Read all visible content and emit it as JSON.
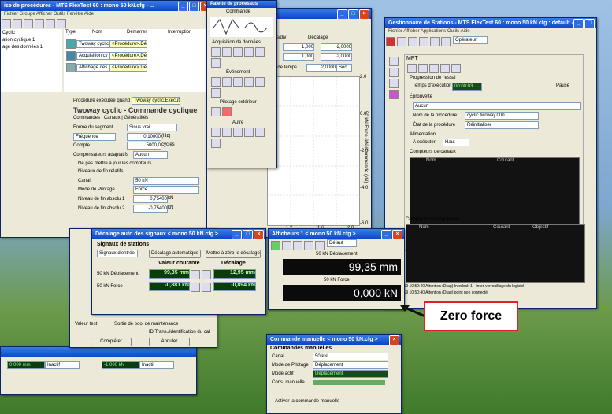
{
  "procwin": {
    "title": "ise de procédures - MTS FlexTest 60 : mono 50 kN.cfg - ...",
    "menu": "Fichier  Groupe  Afficher  Outils  Fenêtre  Aide",
    "tree": [
      "Cyclic",
      "ation cyclique 1",
      "age des données 1"
    ],
    "cols": [
      "Type",
      "Nom",
      "Démarrer",
      "Interruption"
    ],
    "rows": [
      [
        "Twoway cyclic",
        "<Procédure>.Dém"
      ],
      [
        "Acquisition cy",
        "<Procédure>.Dém"
      ],
      [
        "Affichage des",
        "<Procédure>.Dém"
      ]
    ],
    "exec_label": "Procédure exécutée quand",
    "exec_value": "Twoway cyclic.Exécuté",
    "section_title": "Twoway cyclic - Commande cyclique",
    "tabs": "Commandes | Canaux | Généralités",
    "form": [
      [
        "Forme du segment",
        "Sinus vrai"
      ],
      [
        "Fréquence",
        "0,10000",
        "(Hz)"
      ],
      [
        "Compte",
        "5000,0",
        "cycles"
      ],
      [
        "Compensateurs adaptatifs",
        "Aucun"
      ],
      [
        "Ne pas mettre à jour les compteurs",
        ""
      ],
      [
        "Niveaux de fin relatifs",
        ""
      ],
      [
        "Canal",
        "50 kN"
      ],
      [
        "Mode de Pilotage",
        "Force"
      ],
      [
        "Niveau de fin absolu 1",
        "0,75400",
        "kN"
      ],
      [
        "Niveau de fin absolu 2",
        "-0,75400",
        "kN"
      ]
    ]
  },
  "palette": {
    "title": "Palette de processus",
    "sections": [
      "Commande",
      "Acquisition de données",
      "Événement",
      "Pilotage extérieur",
      "Autre"
    ]
  },
  "scope": {
    "cols": [
      "Unités/div",
      "Décalage"
    ],
    "rows": [
      [
        "1,000",
        "-2,0000"
      ],
      [
        "1,000",
        "-2,0000"
      ]
    ],
    "timebase_label": "Base de temps",
    "timebase": "2,0000",
    "unit": "Sec",
    "ylabels": [
      "2.0",
      "0.0",
      "-2.0",
      "-4.0",
      "-6.0"
    ],
    "xlabels": [
      "1.2",
      "1.6",
      "2.0"
    ],
    "axis": "50 kN Force (kN)/Commande (kN)"
  },
  "station": {
    "title": "Gestionnaire de Stations - MTS FlexTest 60 : mono 50 kN.cfg : default -",
    "menu": "Fichier  Afficher  Applications  Outils  Aide",
    "operator": "Opérateur",
    "panel_title": "MPT",
    "progression": "Progression de l'essai",
    "elapsed_label": "Temps d'exécution",
    "elapsed": "00:00:03",
    "pause": "Pause",
    "essai_label": "Éprouvette",
    "essai_value": "Aucun",
    "proc_name_label": "Nom de la procédure",
    "proc_name": "cyclic twoway.000",
    "state_label": "État de la procédure",
    "state": "Réinitialiser",
    "alim_label": "Alimentation",
    "exec_label": "À exécuter",
    "exec": "Haut",
    "counters": "Compteurs de canaux",
    "counter_cols": [
      "Nom",
      "Courant"
    ],
    "seq": "Compteurs de séquences",
    "seq_cols": [
      "Nom",
      "Courant",
      "Objectif"
    ],
    "log": [
      "2019 10:50:40 Attention (Drag) Interlock 1 - Inter-verrouillage du logiciel",
      "2019 10:50:40 Attention (Drag) point non connecté"
    ]
  },
  "offset": {
    "title": "Décalage auto des signaux < mono 50 kN.cfg >",
    "group": "Signaux de stations",
    "sel": "Signaux d'entrée",
    "btn1": "Décalage automatique",
    "btn2": "Mettre à zéro le décalage",
    "col_current": "Valeur courante",
    "col_offset": "Décalage",
    "rows": [
      {
        "label": "50 kN Déplacement",
        "current": "99,35 mm",
        "offset": "12,95 mm"
      },
      {
        "label": "50 kN Force",
        "current": "-0,881 kN",
        "offset": "-0,894 kN"
      }
    ]
  },
  "meters": {
    "title": "Afficheurs 1 < mono 50 kN.cfg >",
    "mode": "Défaut",
    "items": [
      {
        "label": "50 kN Déplacement",
        "value": "99,35 mm"
      },
      {
        "label": "50 kN Force",
        "value": "0,000 kN"
      }
    ]
  },
  "annotation": {
    "text": "Zero force"
  },
  "manual": {
    "title": "Commande manuelle < mono 50 kN.cfg >",
    "group": "Commandes manuelles",
    "fields": [
      [
        "Canal",
        "50 kN"
      ],
      [
        "Mode de Pilotage",
        "Déplacement"
      ],
      [
        "Mode actif",
        "Déplacement"
      ],
      [
        "Cons. manuelle",
        ""
      ]
    ],
    "check": "Activer la commande manuelle"
  },
  "bottom": {
    "values": [
      "0,000 mm",
      "Inactif",
      "-1,000 kN",
      "Inactif"
    ],
    "maint_label": "Valeur test",
    "maint_text": "Sortie de pool de maintenance",
    "maint_text2": "ID Trans./Identification du cal",
    "cmd": "Compléter",
    "cmd2": "Annuler"
  },
  "colors": {
    "accent": "#0a46c8",
    "annotation": "#e0202a",
    "display_bg": "#0b0b0b"
  }
}
